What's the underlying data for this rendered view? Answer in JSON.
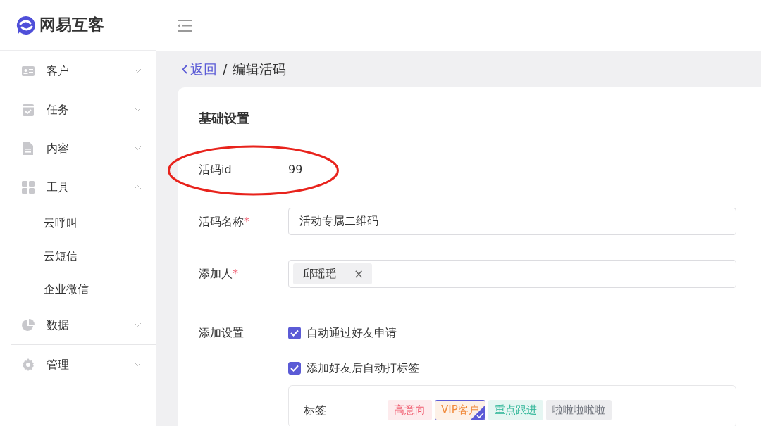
{
  "brand": {
    "name": "网易互客"
  },
  "sidebar": {
    "items": [
      {
        "label": "客户",
        "expanded": false
      },
      {
        "label": "任务",
        "expanded": false
      },
      {
        "label": "内容",
        "expanded": false
      },
      {
        "label": "工具",
        "expanded": true,
        "children": [
          {
            "label": "云呼叫"
          },
          {
            "label": "云短信"
          },
          {
            "label": "企业微信"
          }
        ]
      },
      {
        "label": "数据",
        "expanded": false
      },
      {
        "label": "管理",
        "expanded": false
      }
    ]
  },
  "breadcrumb": {
    "back": "返回",
    "separator": "/",
    "current": "编辑活码"
  },
  "form": {
    "section_title": "基础设置",
    "id_field": {
      "label": "活码id",
      "value": "99",
      "highlighted": true
    },
    "name_field": {
      "label": "活码名称",
      "required_mark": "*",
      "value": "活动专属二维码"
    },
    "adder_field": {
      "label": "添加人",
      "required_mark": "*",
      "chips": [
        {
          "label": "邱瑶瑶",
          "remove": "×"
        }
      ]
    },
    "settings": {
      "label": "添加设置",
      "options": [
        {
          "label": "自动通过好友申请",
          "checked": true
        },
        {
          "label": "添加好友后自动打标签",
          "checked": true
        }
      ]
    },
    "tags": {
      "label": "标签",
      "items": [
        {
          "label": "高意向",
          "color": "#f05a6e",
          "selected": false
        },
        {
          "label": "VIP客户",
          "color": "#f08a3c",
          "selected": true
        },
        {
          "label": "重点跟进",
          "color": "#2bb596",
          "selected": false
        },
        {
          "label": "啦啦啦啦啦",
          "color": "#6b6f78",
          "selected": false
        }
      ]
    }
  }
}
